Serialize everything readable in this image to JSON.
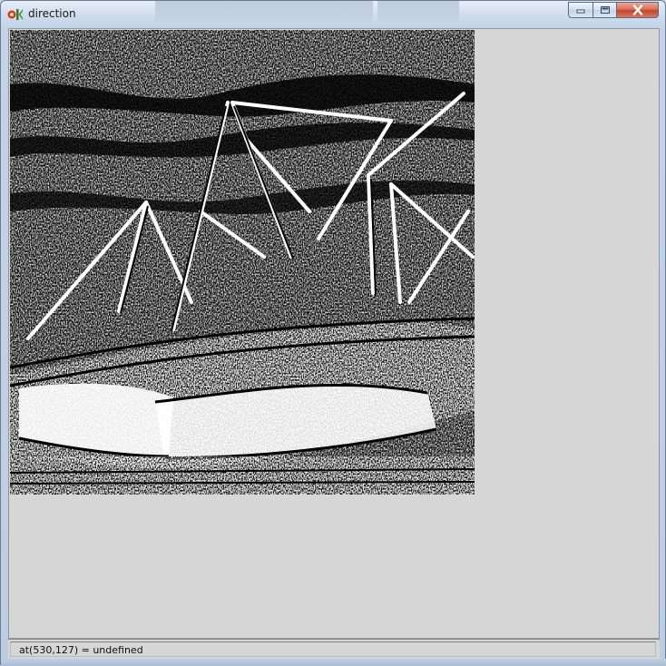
{
  "window": {
    "title": "direction",
    "app_icon": "gtk-logo-icon",
    "controls": {
      "minimize_icon": "minimize-icon",
      "maximize_icon": "maximize-icon",
      "close_icon": "close-icon"
    }
  },
  "image": {
    "description_icon": "edge-direction-image",
    "colors": {
      "foreground": "#ffffff",
      "background": "#000000"
    }
  },
  "status": {
    "text": "at(530,127) = undefined"
  },
  "colors": {
    "client_bg": "#d6d6d6",
    "close_button": "#c3432a",
    "frame": "#c3d4e8"
  }
}
